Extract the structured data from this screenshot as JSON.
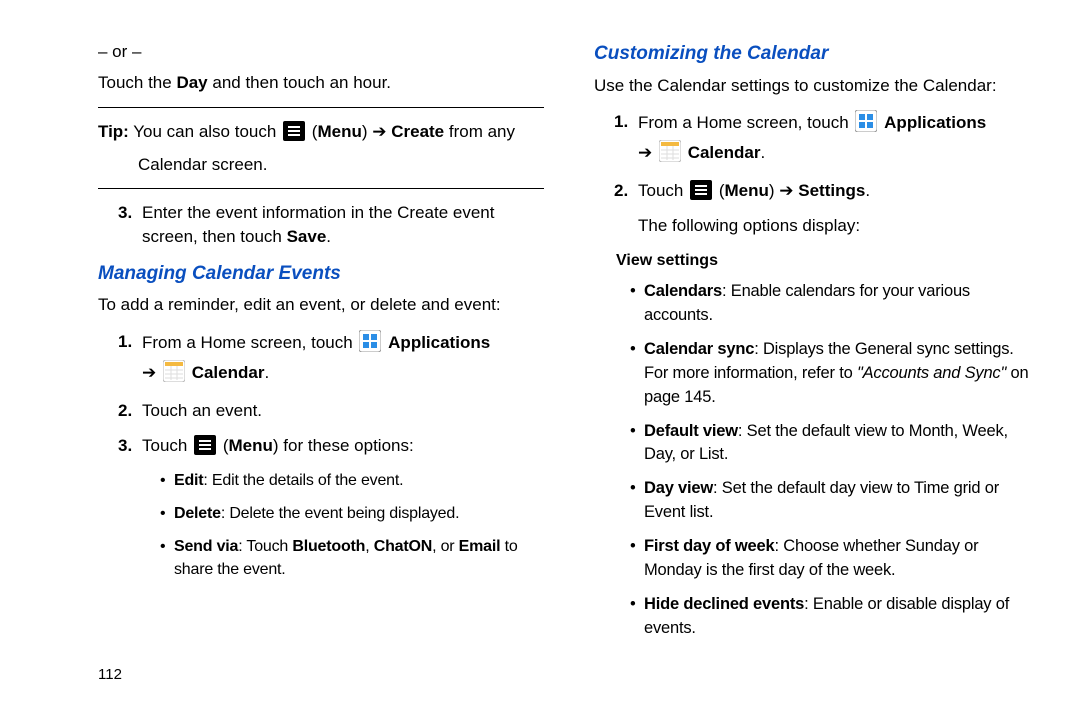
{
  "page_number": "112",
  "left": {
    "or": "– or –",
    "touch_day_pre": "Touch the ",
    "touch_day_bold": "Day",
    "touch_day_post": " and then touch an hour.",
    "tip_label": "Tip:",
    "tip_pre": " You can also touch ",
    "tip_menu_open": "(",
    "tip_menu": "Menu",
    "tip_menu_close": ")",
    "tip_create": "Create",
    "tip_post": " from any",
    "tip_line2": "Calendar screen.",
    "step3_num": "3.",
    "step3_pre": "Enter the event information in the Create event screen, then touch ",
    "step3_save": "Save",
    "step3_post": ".",
    "heading_manage": "Managing Calendar Events",
    "manage_intro": "To add a reminder, edit an event, or delete and event:",
    "m1_num": "1.",
    "m1_pre": "From a Home screen, touch ",
    "m1_apps": "Applications",
    "m1_cal": "Calendar",
    "m1_post": ".",
    "m2_num": "2.",
    "m2_text": "Touch an event.",
    "m3_num": "3.",
    "m3_pre": "Touch ",
    "m3_menu_open": "(",
    "m3_menu": "Menu",
    "m3_menu_close": ")",
    "m3_post": " for these options:",
    "m3_edit_b": "Edit",
    "m3_edit_t": ": Edit the details of the event.",
    "m3_del_b": "Delete",
    "m3_del_t": ": Delete the event being displayed.",
    "m3_send_b": "Send via",
    "m3_send_pre": ": Touch ",
    "m3_bt": "Bluetooth",
    "m3_comma": ", ",
    "m3_chaton": "ChatON",
    "m3_or": ", or ",
    "m3_email": "Email",
    "m3_send_post": " to share the event."
  },
  "right": {
    "heading_custom": "Customizing the Calendar",
    "custom_intro": "Use the Calendar settings to customize the Calendar:",
    "c1_num": "1.",
    "c1_pre": "From a Home screen, touch ",
    "c1_apps": "Applications",
    "c1_cal": "Calendar",
    "c1_post": ".",
    "c2_num": "2.",
    "c2_pre": "Touch ",
    "c2_menu_open": "(",
    "c2_menu": "Menu",
    "c2_menu_close": ")",
    "c2_settings": "Settings",
    "c2_post": ".",
    "c2_following": "The following options display:",
    "view_settings": "View settings",
    "vs_cal_b": "Calendars",
    "vs_cal_t": ": Enable calendars for your various accounts.",
    "vs_sync_b": "Calendar sync",
    "vs_sync_t_pre": ": Displays the General sync settings. For more information, refer to ",
    "vs_sync_ref": "\"Accounts and Sync\"",
    "vs_sync_t_post": "  on page 145.",
    "vs_def_b": "Default view",
    "vs_def_t": ": Set the default view to Month, Week, Day, or List.",
    "vs_day_b": "Day view",
    "vs_day_t": ": Set the default day view to Time grid or Event list.",
    "vs_fdw_b": "First day of week",
    "vs_fdw_t": ": Choose whether Sunday or Monday is the first day of the week.",
    "vs_hide_b": "Hide declined events",
    "vs_hide_t": ": Enable or disable display of events."
  }
}
